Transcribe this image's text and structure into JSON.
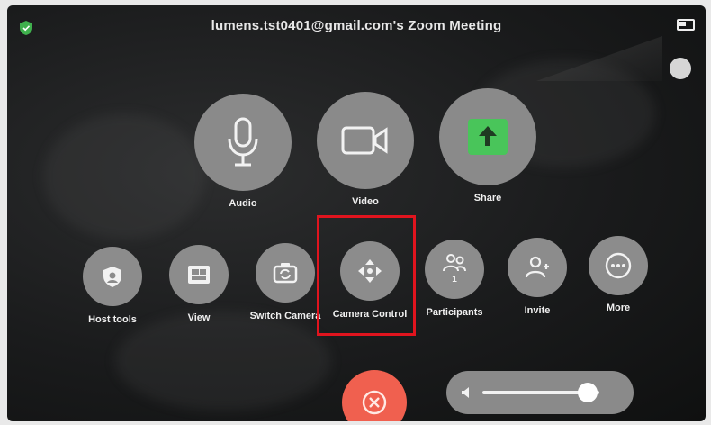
{
  "meeting": {
    "title": "lumens.tst0401@gmail.com's Zoom Meeting"
  },
  "icons": {
    "top_left": "shield-icon",
    "top_right": "battery-icon",
    "side": "circle-indicator-icon",
    "end": "end-call-x-icon",
    "volume": "speaker-icon"
  },
  "colors": {
    "share_green": "#49c55a",
    "end_red": "#f0604f",
    "highlight_red": "#e0141e",
    "button_gray": "#8a8a8a"
  },
  "main_controls": [
    {
      "label": "Audio",
      "icon": "microphone-icon"
    },
    {
      "label": "Video",
      "icon": "video-camera-icon"
    },
    {
      "label": "Share",
      "icon": "share-arrow-up-icon"
    }
  ],
  "secondary_controls": [
    {
      "label": "Host tools",
      "icon": "host-tools-shield-icon"
    },
    {
      "label": "View",
      "icon": "view-layout-icon"
    },
    {
      "label": "Switch Camera",
      "icon": "switch-camera-icon"
    },
    {
      "label": "Camera Control",
      "icon": "camera-control-arrows-icon"
    },
    {
      "label": "Participants",
      "icon": "participants-icon",
      "count": "1"
    },
    {
      "label": "Invite",
      "icon": "invite-person-plus-icon"
    },
    {
      "label": "More",
      "icon": "more-dots-icon"
    }
  ],
  "volume": {
    "level": 0.9
  }
}
